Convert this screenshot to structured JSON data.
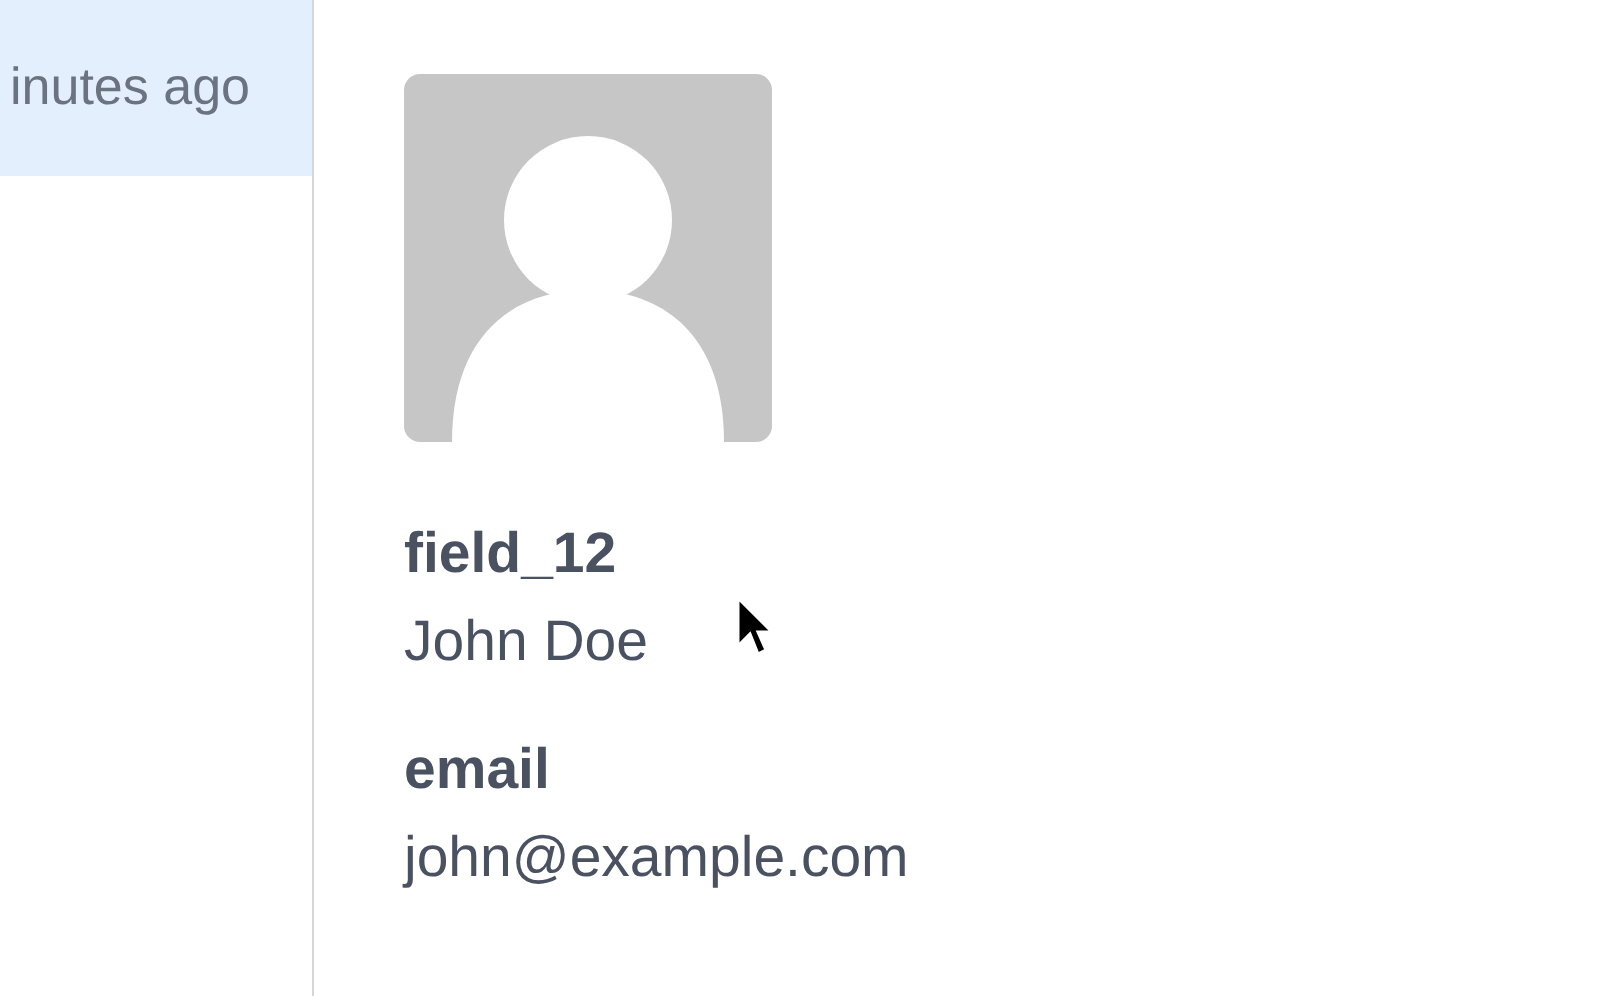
{
  "sidebar": {
    "items": [
      {
        "time": "inutes ago",
        "selected": true
      }
    ]
  },
  "fields": [
    {
      "label": "field_12",
      "value": "John Doe"
    },
    {
      "label": "email",
      "value": "john@example.com"
    }
  ]
}
